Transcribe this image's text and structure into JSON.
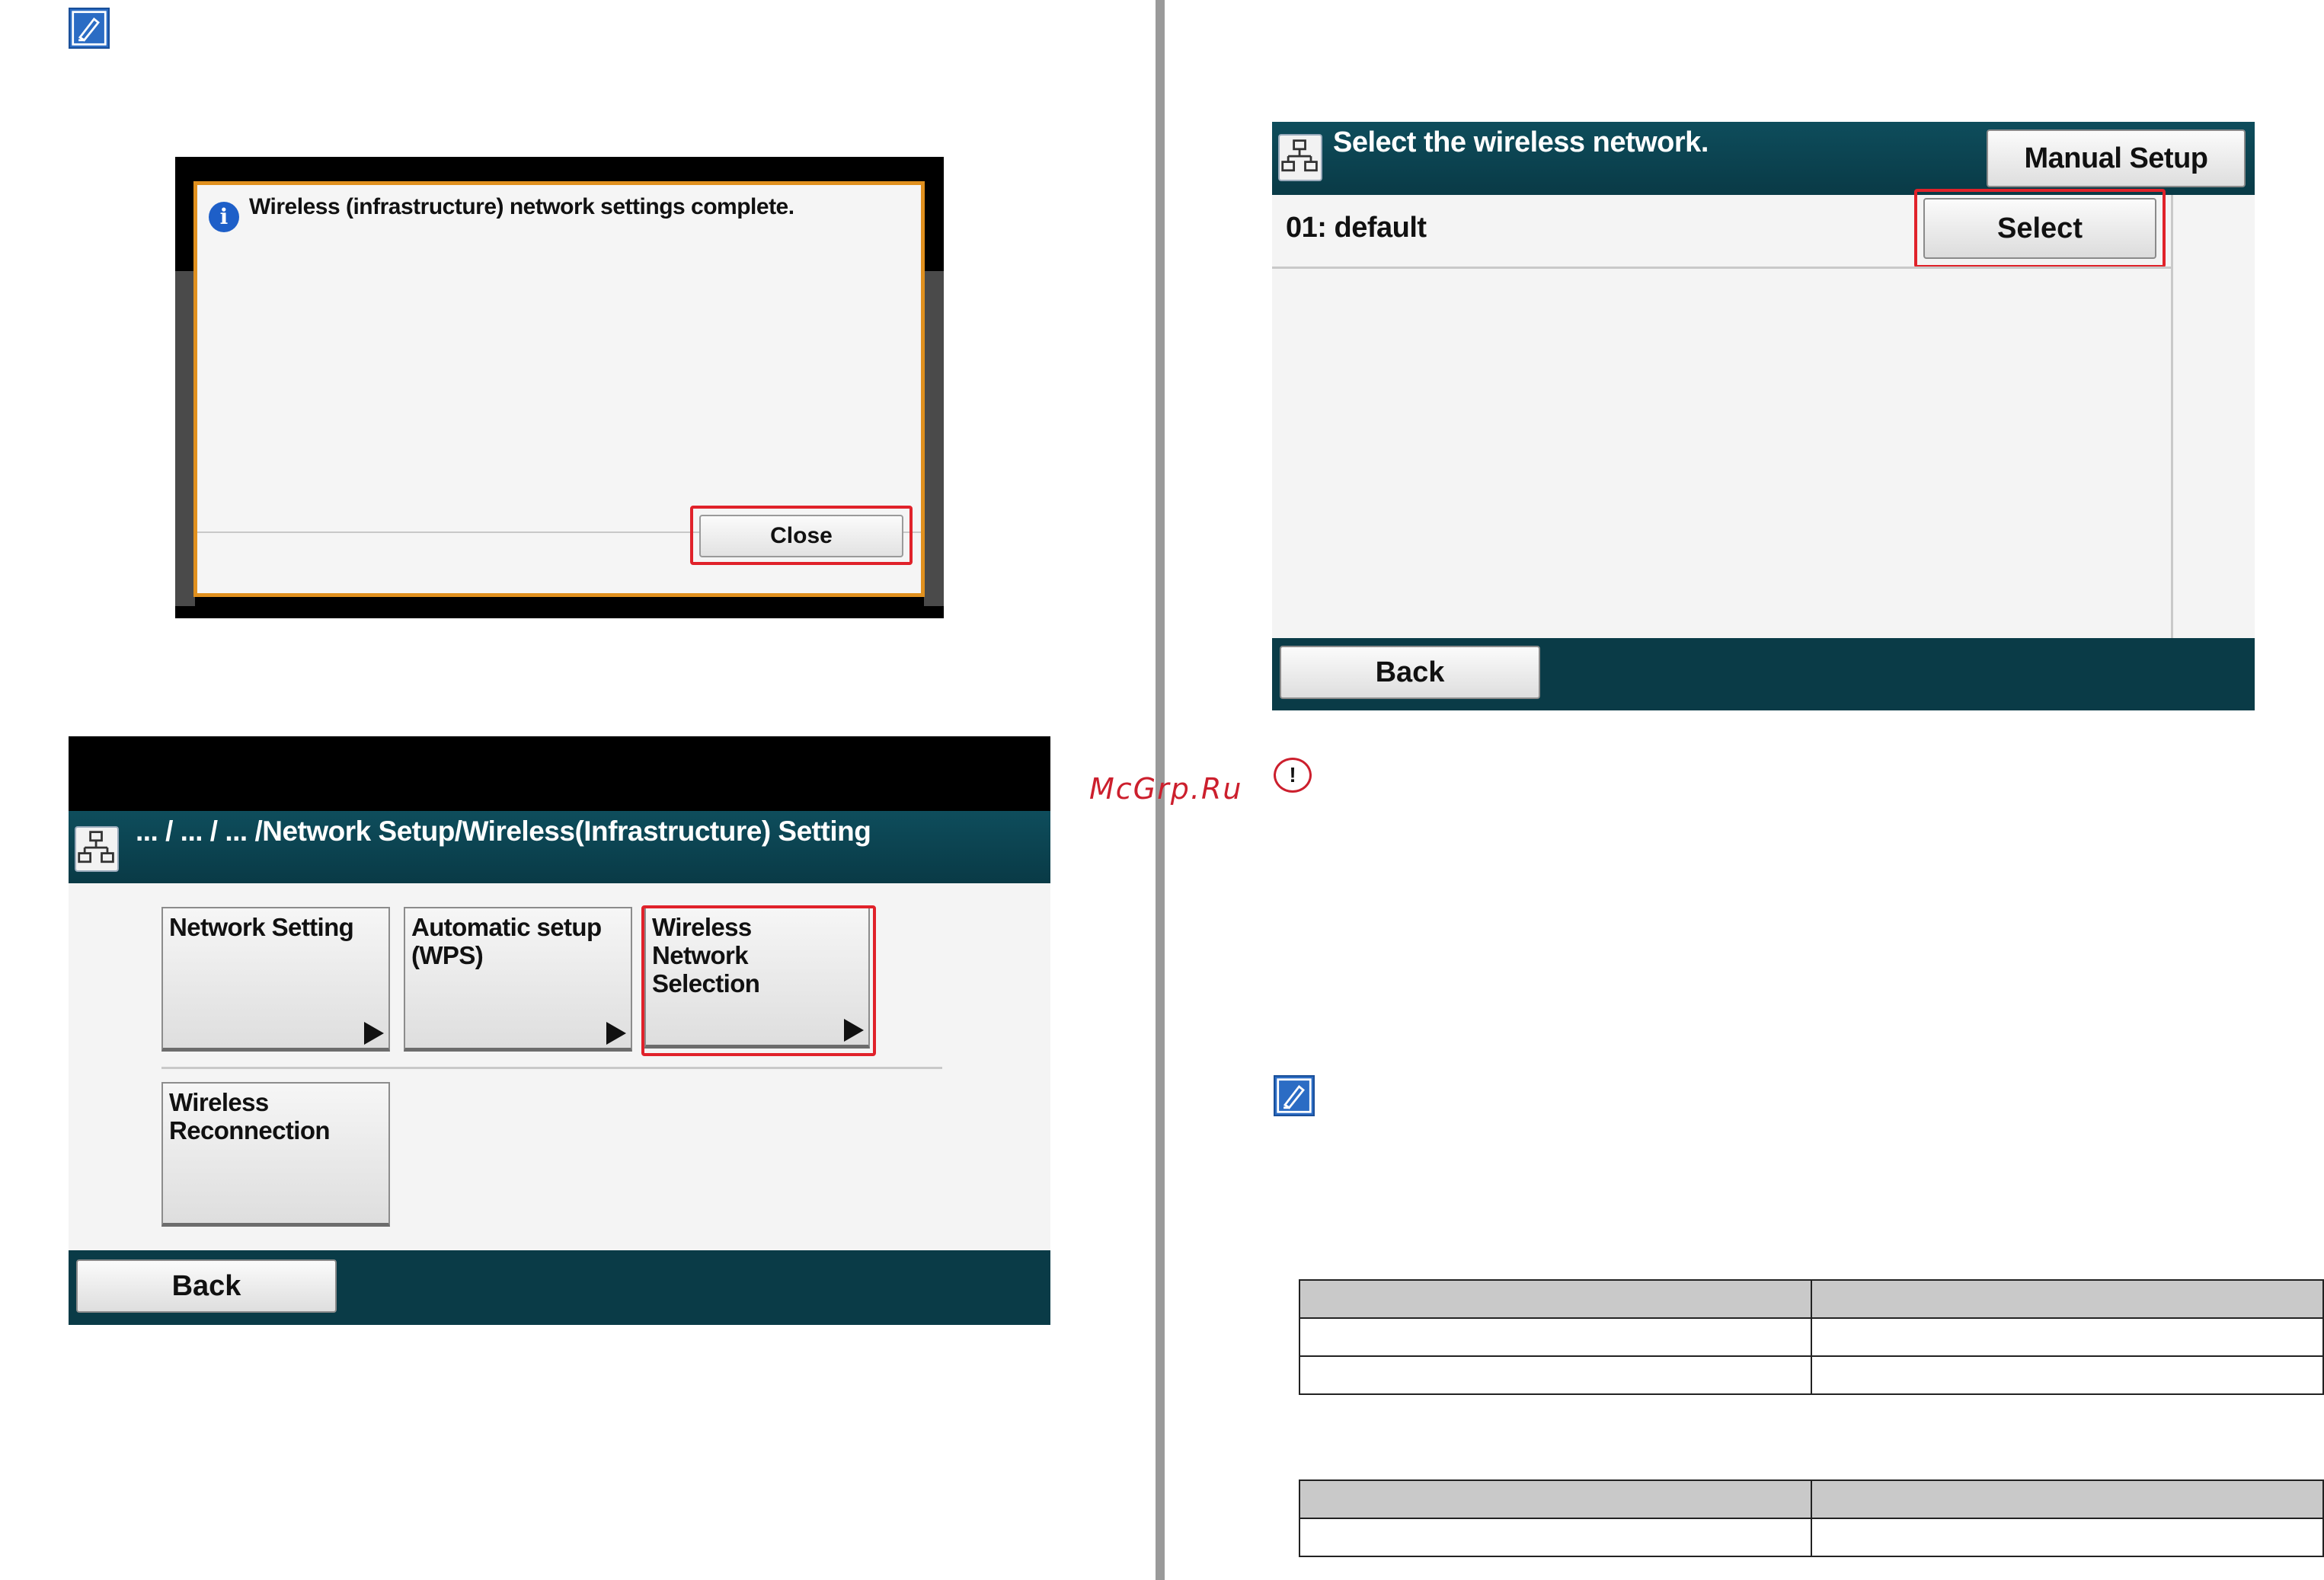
{
  "icons": {
    "memo": "memo-pencil-icon",
    "info": "info-icon",
    "network": "network-icon",
    "caution": "caution-icon"
  },
  "colors": {
    "highlight": "#e0222a",
    "header_teal": "#0a3b47",
    "dialog_border": "#e0901e",
    "info_blue": "#1e5fc8"
  },
  "completion_dialog": {
    "info_glyph": "i",
    "message": "Wireless (infrastructure) network settings complete.",
    "close_label": "Close"
  },
  "network_menu": {
    "breadcrumb": "... / ... / ... /Network Setup/Wireless(Infrastructure) Setting",
    "tiles": [
      {
        "label": "Network Setting"
      },
      {
        "label": "Automatic setup (WPS)"
      },
      {
        "label": "Wireless Network Selection"
      },
      {
        "label": "Wireless Reconnection"
      }
    ],
    "back_label": "Back"
  },
  "wireless_select": {
    "title": "Select the wireless network.",
    "manual_setup_label": "Manual Setup",
    "networks": [
      {
        "label": "01: default",
        "select_label": "Select"
      }
    ],
    "back_label": "Back"
  },
  "caution": {
    "glyph": "!"
  },
  "watermark": "McGrp.Ru",
  "tables": [
    {
      "rows": [
        [
          "",
          ""
        ],
        [
          "",
          ""
        ],
        [
          "",
          ""
        ]
      ]
    },
    {
      "rows": [
        [
          "",
          ""
        ],
        [
          "",
          ""
        ]
      ]
    }
  ]
}
